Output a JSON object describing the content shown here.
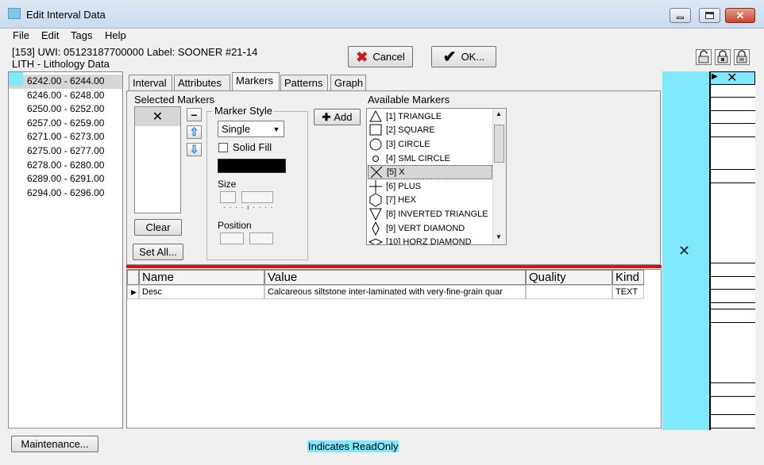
{
  "window": {
    "title": "Edit Interval Data",
    "close_glyph": "✕"
  },
  "menu": [
    "File",
    "Edit",
    "Tags",
    "Help"
  ],
  "header": {
    "line1": "[153] UWI: 05123187700000  Label: SOONER #21-14",
    "line2": "LITH - Lithology Data",
    "cancel_label": "Cancel",
    "ok_label": "OK..."
  },
  "intervals": {
    "items": [
      "6242.00 - 6244.00",
      "6246.00 - 6248.00",
      "6250.00 - 6252.00",
      "6257.00 - 6259.00",
      "6271.00 - 6273.00",
      "6275.00 - 6277.00",
      "6278.00 - 6280.00",
      "6289.00 - 6291.00",
      "6294.00 - 6296.00"
    ],
    "selected_index": 0
  },
  "tabs": {
    "items": [
      "Interval",
      "Attributes",
      "Markers",
      "Patterns",
      "Graph"
    ],
    "active": "Markers"
  },
  "markers": {
    "selected_title": "Selected Markers",
    "selected_items": [
      "✕"
    ],
    "clear_label": "Clear",
    "set_all_label": "Set All...",
    "style_title": "Marker Style",
    "style_value": "Single",
    "solid_fill_label": "Solid Fill",
    "solid_fill_checked": false,
    "fill_color": "#000000",
    "size_label": "Size",
    "position_label": "Position",
    "add_label": "Add",
    "available_title": "Available Markers",
    "available_items": [
      {
        "label": "[1] TRIANGLE",
        "icon": "triangle-icon"
      },
      {
        "label": "[2] SQUARE",
        "icon": "square-icon"
      },
      {
        "label": "[3] CIRCLE",
        "icon": "circle-icon"
      },
      {
        "label": "[4] SML CIRCLE",
        "icon": "small-circle-icon"
      },
      {
        "label": "[5] X",
        "icon": "x-icon"
      },
      {
        "label": "[6] PLUS",
        "icon": "plus-icon"
      },
      {
        "label": "[7] HEX",
        "icon": "hex-icon"
      },
      {
        "label": "[8] INVERTED TRIANGLE",
        "icon": "inverted-triangle-icon"
      },
      {
        "label": "[9] VERT DIAMOND",
        "icon": "vert-diamond-icon"
      },
      {
        "label": "[10] HORZ DIAMOND",
        "icon": "horz-diamond-icon"
      }
    ],
    "available_selected_index": 4
  },
  "grid": {
    "columns": [
      "Name",
      "Value",
      "Quality",
      "Kind"
    ],
    "rows": [
      {
        "name": "Desc",
        "value": "Calcareous siltstone inter-laminated with very-fine-grain quar",
        "quality": "",
        "kind": "TEXT"
      }
    ]
  },
  "preview": {
    "marker": "✕",
    "highlight_color": "#80e8ff"
  },
  "footer": {
    "maintenance_label": "Maintenance...",
    "readonly_note": "Indicates ReadOnly"
  }
}
